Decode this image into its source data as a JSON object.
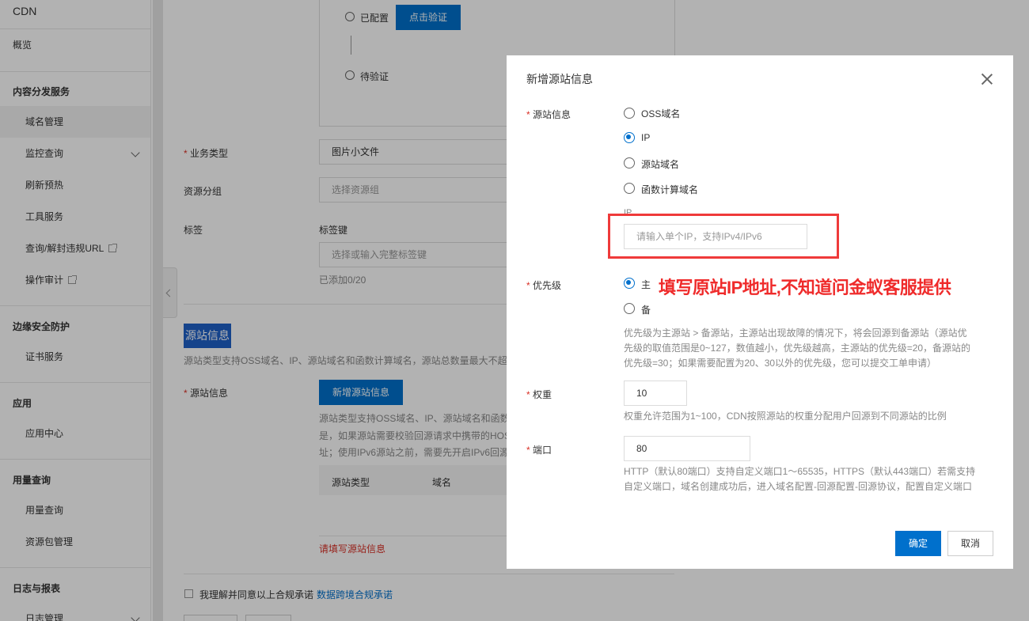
{
  "sidebar": {
    "title": "CDN",
    "overview": "概览",
    "section_content": "内容分发服务",
    "domain_mgmt": "域名管理",
    "monitor": "监控查询",
    "refresh": "刷新预热",
    "tools": "工具服务",
    "query_url": "查询/解封违规URL",
    "audit": "操作审计",
    "section_edge": "边缘安全防护",
    "cert": "证书服务",
    "section_app": "应用",
    "app_center": "应用中心",
    "section_usage": "用量查询",
    "usage_query": "用量查询",
    "package_mgmt": "资源包管理",
    "section_logs": "日志与报表",
    "log_mgmt": "日志管理"
  },
  "bg_form": {
    "configured": "已配置",
    "verify_btn": "点击验证",
    "pending": "待验证",
    "biz_type_label": "业务类型",
    "biz_type_value": "图片小文件",
    "resource_group_label": "资源分组",
    "resource_group_placeholder": "选择资源组",
    "tag_label": "标签",
    "tag_key_label": "标签键",
    "tag_key_placeholder": "选择或输入完整标签键",
    "tag_added": "已添加0/20",
    "origin_section": "源站信息",
    "origin_desc": "源站类型支持OSS域名、IP、源站域名和函数计算域名，源站总数量最大不超过",
    "origin_label": "源站信息",
    "add_origin_btn": "新增源站信息",
    "origin_help_1": "源站类型支持OSS域名、IP、源站域名和函数",
    "origin_help_2": "是，如果源站需要校验回源请求中携带的HOS",
    "origin_help_3": "址；使用IPv6源站之前，需要先开启IPv6回源",
    "col_type": "源站类型",
    "col_domain": "域名",
    "origin_error": "请填写源站信息",
    "agree_text": "我理解并同意以上合规承诺",
    "agree_link": "数据跨境合规承诺"
  },
  "dialog": {
    "title": "新增源站信息",
    "origin_info_label": "源站信息",
    "opt_oss": "OSS域名",
    "opt_ip": "IP",
    "opt_domain": "源站域名",
    "opt_fc": "函数计算域名",
    "ip_label": "IP",
    "ip_placeholder": "请输入单个IP，支持IPv4/IPv6",
    "priority_label": "优先级",
    "priority_main": "主",
    "priority_backup": "备",
    "priority_help": [
      "优先级为主源站 > 备源站，主源站出现故障的情况下，将会回源到备源站（源站优",
      "先级的取值范围是0~127，数值越小，优先级越高，主源站的优先级=20，备源站的",
      "优先级=30；如果需要配置为20、30以外的优先级，您可以提交工单申请）"
    ],
    "weight_label": "权重",
    "weight_value": "10",
    "weight_help": "权重允许范围为1~100，CDN按照源站的权重分配用户回源到不同源站的比例",
    "port_label": "端口",
    "port_value": "80",
    "port_help": [
      "HTTP（默认80端口）支持自定义端口1～65535，HTTPS（默认443端口）若需支持",
      "自定义端口，域名创建成功后，进入域名配置-回源配置-回源协议，配置自定义端口"
    ],
    "ok_btn": "确定",
    "cancel_btn": "取消"
  },
  "annotation": {
    "text": "填写原站IP地址,不知道问金蚁客服提供"
  },
  "colors": {
    "primary": "#0070cc",
    "error": "#d93026",
    "annotation": "#ef2b2b"
  }
}
